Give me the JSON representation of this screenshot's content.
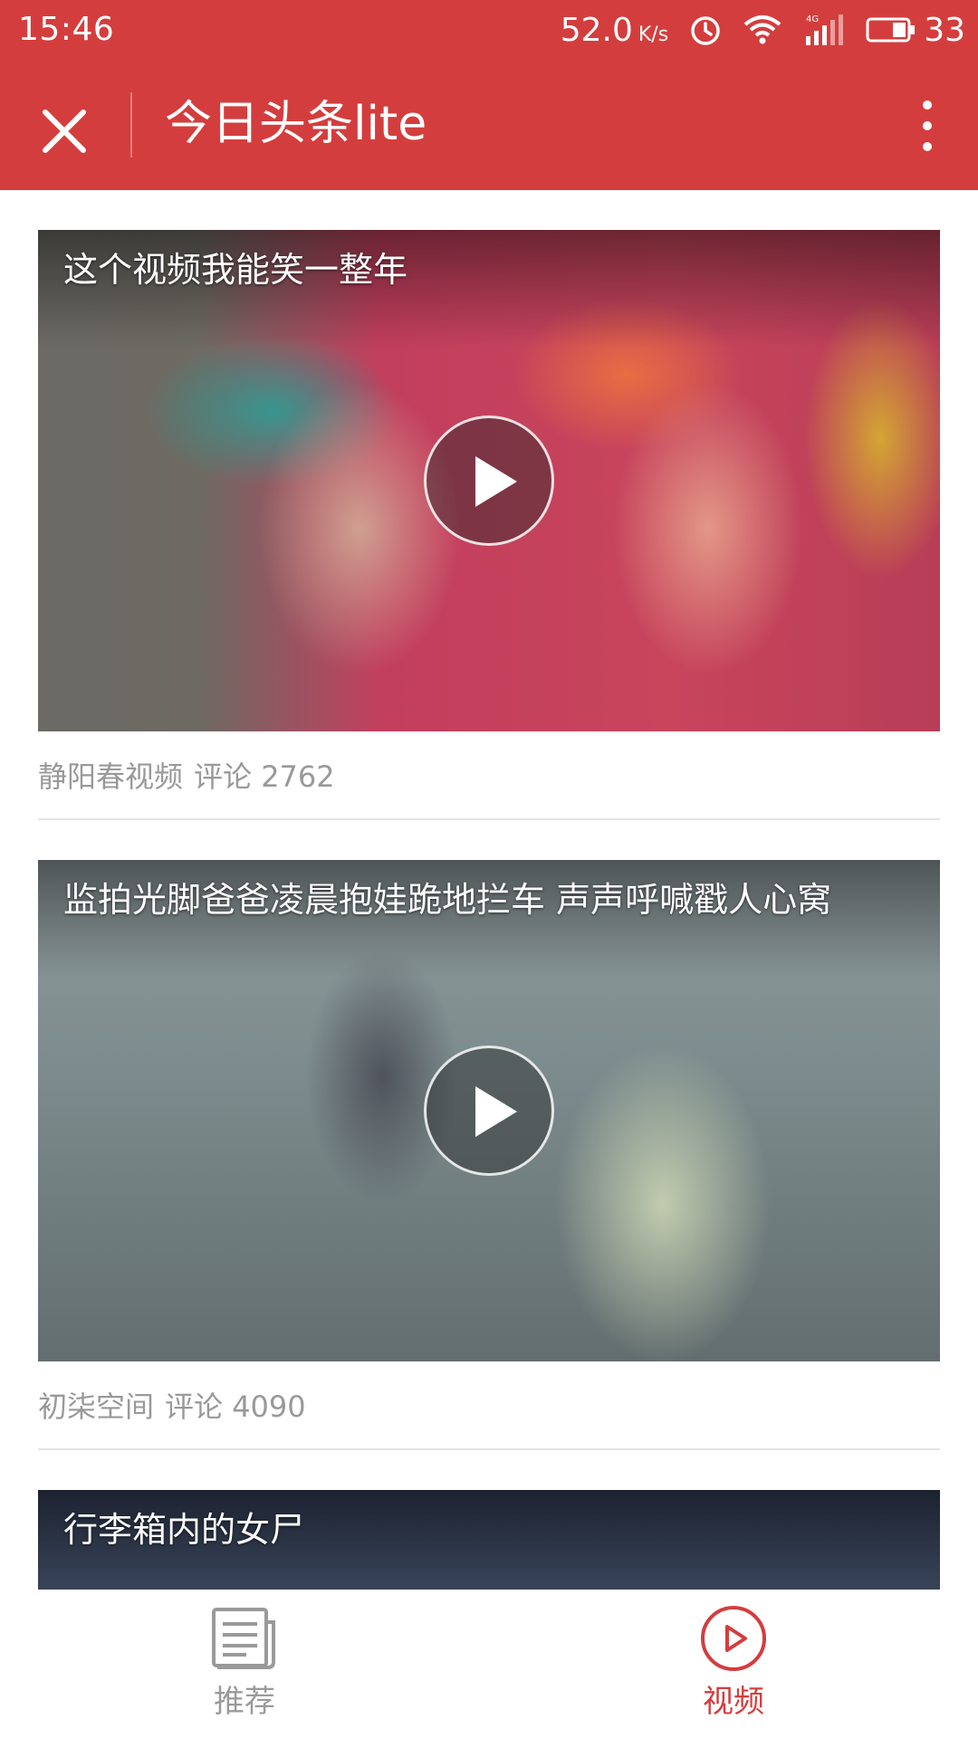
{
  "status_bar": {
    "time": "15:46",
    "net_speed": "52.0",
    "net_speed_unit": "K/s",
    "network_type": "4G",
    "battery_level": "33"
  },
  "header": {
    "title": "今日头条lite",
    "color": "#d43d3d"
  },
  "feed": {
    "items": [
      {
        "title": "这个视频我能笑一整年",
        "source": "静阳春视频",
        "comments": "评论 2762"
      },
      {
        "title": "监拍光脚爸爸凌晨抱娃跪地拦车 声声呼喊戳人心窝",
        "source": "初柒空间",
        "comments": "评论 4090"
      },
      {
        "title": "行李箱内的女尸"
      }
    ]
  },
  "tab_bar": {
    "tabs": [
      {
        "label": "推荐",
        "icon": "newspaper-icon",
        "active": false
      },
      {
        "label": "视频",
        "icon": "play-circle-icon",
        "active": true
      }
    ],
    "active_color": "#d43d3d",
    "inactive_color": "#9a9a9a"
  }
}
